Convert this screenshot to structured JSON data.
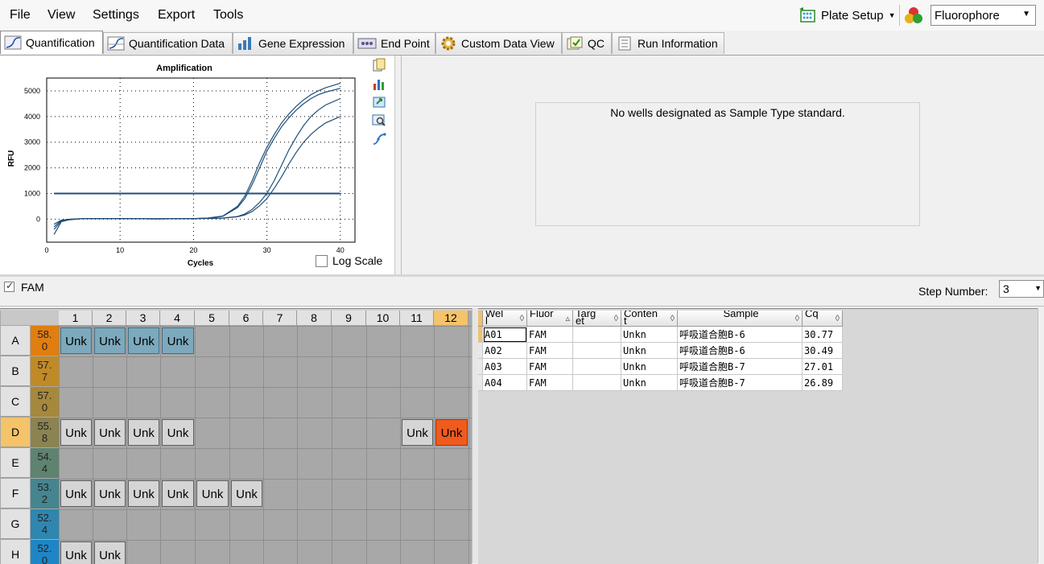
{
  "menu": [
    "File",
    "View",
    "Settings",
    "Export",
    "Tools"
  ],
  "toolbar": {
    "plate_setup": "Plate Setup",
    "view_select": "Fluorophore"
  },
  "tabs": [
    {
      "label": "Quantification",
      "active": true
    },
    {
      "label": "Quantification Data"
    },
    {
      "label": "Gene Expression"
    },
    {
      "label": "End Point"
    },
    {
      "label": "Custom Data View"
    },
    {
      "label": "QC"
    },
    {
      "label": "Run Information"
    }
  ],
  "chart_data": {
    "type": "line",
    "title": "Amplification",
    "xlabel": "Cycles",
    "ylabel": "RFU",
    "xlim": [
      0,
      42
    ],
    "ylim": [
      -900,
      5500
    ],
    "xticks": [
      0,
      10,
      20,
      30,
      40
    ],
    "yticks": [
      0,
      1000,
      2000,
      3000,
      4000,
      5000
    ],
    "threshold": 1000,
    "colors": {
      "curves": "#1f4e79",
      "threshold": "#1f4e79"
    },
    "series": [
      {
        "x": [
          1,
          2,
          3,
          5,
          10,
          15,
          20,
          22,
          24,
          26,
          27,
          28,
          29,
          30,
          31,
          32,
          33,
          34,
          35,
          36,
          37,
          38,
          40
        ],
        "y": [
          -600,
          -100,
          -30,
          20,
          20,
          10,
          20,
          40,
          120,
          500,
          900,
          1500,
          2200,
          2800,
          3300,
          3750,
          4100,
          4400,
          4650,
          4850,
          5000,
          5120,
          5300
        ]
      },
      {
        "x": [
          1,
          2,
          3,
          5,
          10,
          15,
          20,
          22,
          24,
          26,
          27,
          28,
          29,
          30,
          31,
          32,
          33,
          34,
          35,
          36,
          37,
          38,
          40
        ],
        "y": [
          -400,
          -80,
          -20,
          20,
          20,
          10,
          20,
          40,
          110,
          450,
          800,
          1350,
          2000,
          2650,
          3150,
          3600,
          3950,
          4250,
          4500,
          4700,
          4850,
          4950,
          5100
        ]
      },
      {
        "x": [
          1,
          2,
          3,
          5,
          10,
          15,
          20,
          22,
          24,
          26,
          27,
          28,
          29,
          30,
          31,
          32,
          33,
          34,
          35,
          36,
          37,
          38,
          40
        ],
        "y": [
          -300,
          -50,
          -10,
          20,
          20,
          10,
          20,
          25,
          40,
          100,
          200,
          380,
          650,
          1000,
          1500,
          2100,
          2700,
          3200,
          3650,
          4000,
          4250,
          4450,
          4700
        ]
      },
      {
        "x": [
          1,
          2,
          3,
          5,
          10,
          15,
          20,
          22,
          24,
          26,
          27,
          28,
          29,
          30,
          31,
          32,
          33,
          34,
          35,
          36,
          37,
          38,
          40
        ],
        "y": [
          -200,
          -40,
          -10,
          20,
          20,
          10,
          20,
          25,
          35,
          90,
          160,
          300,
          520,
          800,
          1200,
          1650,
          2150,
          2600,
          3000,
          3300,
          3550,
          3750,
          4000
        ]
      }
    ]
  },
  "log_scale_label": "Log Scale",
  "message": "No wells designated as Sample Type standard.",
  "fam_label": "FAM",
  "step_label": "Step Number:",
  "step_value": "3",
  "plate": {
    "columns": [
      "1",
      "2",
      "3",
      "4",
      "5",
      "6",
      "7",
      "8",
      "9",
      "10",
      "11",
      "12"
    ],
    "rows": [
      {
        "label": "A",
        "temp": "58.\n0",
        "temp_color": "#e07e10"
      },
      {
        "label": "B",
        "temp": "57.\n7",
        "temp_color": "#c08a27"
      },
      {
        "label": "C",
        "temp": "57.\n0",
        "temp_color": "#a6883d"
      },
      {
        "label": "D",
        "temp": "55.\n8",
        "temp_color": "#8b8352"
      },
      {
        "label": "E",
        "temp": "54.\n4",
        "temp_color": "#5f8370"
      },
      {
        "label": "F",
        "temp": "53.\n2",
        "temp_color": "#458590"
      },
      {
        "label": "G",
        "temp": "52.\n4",
        "temp_color": "#2f86ae"
      },
      {
        "label": "H",
        "temp": "52.\n0",
        "temp_color": "#1e86c6"
      }
    ],
    "well_label": "Unk",
    "wells": [
      {
        "row": 0,
        "col": 0,
        "state": "blue"
      },
      {
        "row": 0,
        "col": 1,
        "state": "blue"
      },
      {
        "row": 0,
        "col": 2,
        "state": "blue"
      },
      {
        "row": 0,
        "col": 3,
        "state": "blue"
      },
      {
        "row": 3,
        "col": 0,
        "state": "grey"
      },
      {
        "row": 3,
        "col": 1,
        "state": "grey"
      },
      {
        "row": 3,
        "col": 2,
        "state": "grey"
      },
      {
        "row": 3,
        "col": 3,
        "state": "grey"
      },
      {
        "row": 3,
        "col": 10,
        "state": "grey"
      },
      {
        "row": 3,
        "col": 11,
        "state": "red"
      },
      {
        "row": 5,
        "col": 0,
        "state": "grey"
      },
      {
        "row": 5,
        "col": 1,
        "state": "grey"
      },
      {
        "row": 5,
        "col": 2,
        "state": "grey"
      },
      {
        "row": 5,
        "col": 3,
        "state": "grey"
      },
      {
        "row": 5,
        "col": 4,
        "state": "grey"
      },
      {
        "row": 5,
        "col": 5,
        "state": "grey"
      },
      {
        "row": 7,
        "col": 0,
        "state": "grey"
      },
      {
        "row": 7,
        "col": 1,
        "state": "grey"
      }
    ]
  },
  "table": {
    "headers": [
      "Wel\nl",
      "Fluor",
      "Targ\net",
      "Conten\nt",
      "Sample",
      "Cq"
    ],
    "rows": [
      [
        "A01",
        "FAM",
        "",
        "Unkn",
        "呼吸道合胞B-6",
        "30.77"
      ],
      [
        "A02",
        "FAM",
        "",
        "Unkn",
        "呼吸道合胞B-6",
        "30.49"
      ],
      [
        "A03",
        "FAM",
        "",
        "Unkn",
        "呼吸道合胞B-7",
        "27.01"
      ],
      [
        "A04",
        "FAM",
        "",
        "Unkn",
        "呼吸道合胞B-7",
        "26.89"
      ]
    ]
  }
}
